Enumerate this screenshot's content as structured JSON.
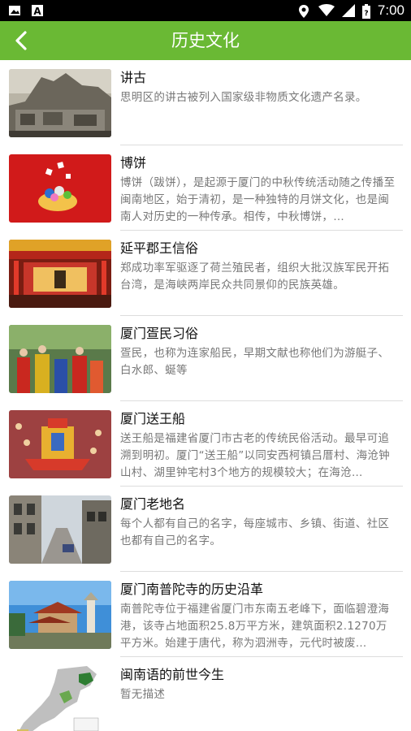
{
  "status_bar": {
    "time": "7:00",
    "icons": [
      "image-icon",
      "a-icon",
      "location-icon",
      "wifi-icon",
      "signal-icon",
      "battery-icon"
    ]
  },
  "header": {
    "title": "历史文化",
    "back_icon": "chevron-left-icon",
    "background_color": "#6ab934"
  },
  "items": [
    {
      "title": "讲古",
      "description": "思明区的讲古被列入国家级非物质文化遗产名录。"
    },
    {
      "title": "博饼",
      "description": "博饼（跋饼），是起源于厦门的中秋传统活动随之传播至闽南地区，始于清初，是一种独特的月饼文化，也是闽南人对历史的一种传承。相传，中秋博饼，…"
    },
    {
      "title": "延平郡王信俗",
      "description": "郑成功率军驱逐了荷兰殖民者，组织大批汉族军民开拓台湾，是海峡两岸民众共同景仰的民族英雄。"
    },
    {
      "title": "厦门疍民习俗",
      "description": "疍民，也称为连家船民，早期文献也称他们为游艇子、白水郎、蜒等"
    },
    {
      "title": "厦门送王船",
      "description": "送王船是福建省厦门市古老的传统民俗活动。最早可追溯到明初。厦门“送王船”以同安西柯镇吕厝村、海沧钟山村、湖里钟宅村3个地方的规模较大；在海沧…"
    },
    {
      "title": "厦门老地名",
      "description": "每个人都有自己的名字，每座城市、乡镇、街道、社区也都有自己的名字。"
    },
    {
      "title": "厦门南普陀寺的历史沿革",
      "description": "南普陀寺位于福建省厦门市东南五老峰下，面临碧澄海港，该寺占地面积25.8万平方米，建筑面积2.1270万平方米。始建于唐代，称为泗洲寺，元代时被废…"
    },
    {
      "title": "闽南语的前世今生",
      "description": "暂无描述"
    }
  ]
}
